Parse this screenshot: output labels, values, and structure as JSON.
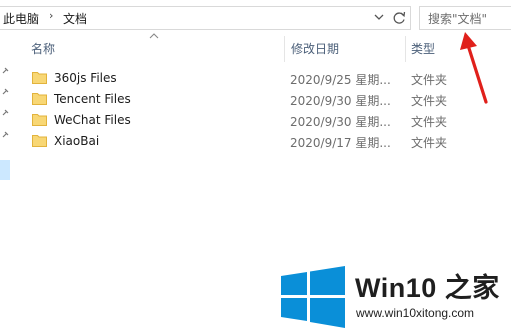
{
  "address_bar": {
    "breadcrumbs": [
      "此电脑",
      "文档"
    ],
    "separator": "›",
    "dropdown_icon": "chevron-down-icon",
    "refresh_icon": "refresh-icon"
  },
  "search": {
    "placeholder": "搜索\"文档\""
  },
  "columns": {
    "name": "名称",
    "date": "修改日期",
    "type": "类型"
  },
  "files": [
    {
      "name": "360js Files",
      "date": "2020/9/25 星期...",
      "type": "文件夹"
    },
    {
      "name": "Tencent Files",
      "date": "2020/9/30 星期...",
      "type": "文件夹"
    },
    {
      "name": "WeChat Files",
      "date": "2020/9/30 星期...",
      "type": "文件夹"
    },
    {
      "name": "XiaoBai",
      "date": "2020/9/17 星期...",
      "type": "文件夹"
    }
  ],
  "watermark": {
    "brand": "Win10 之家",
    "url": "www.win10xitong.com"
  },
  "colors": {
    "folder": "#f8d775",
    "folder_edge": "#e2b33c",
    "annotation": "#e0201b",
    "logo_blue": "#0a8fd8",
    "selection": "#cce8ff"
  }
}
